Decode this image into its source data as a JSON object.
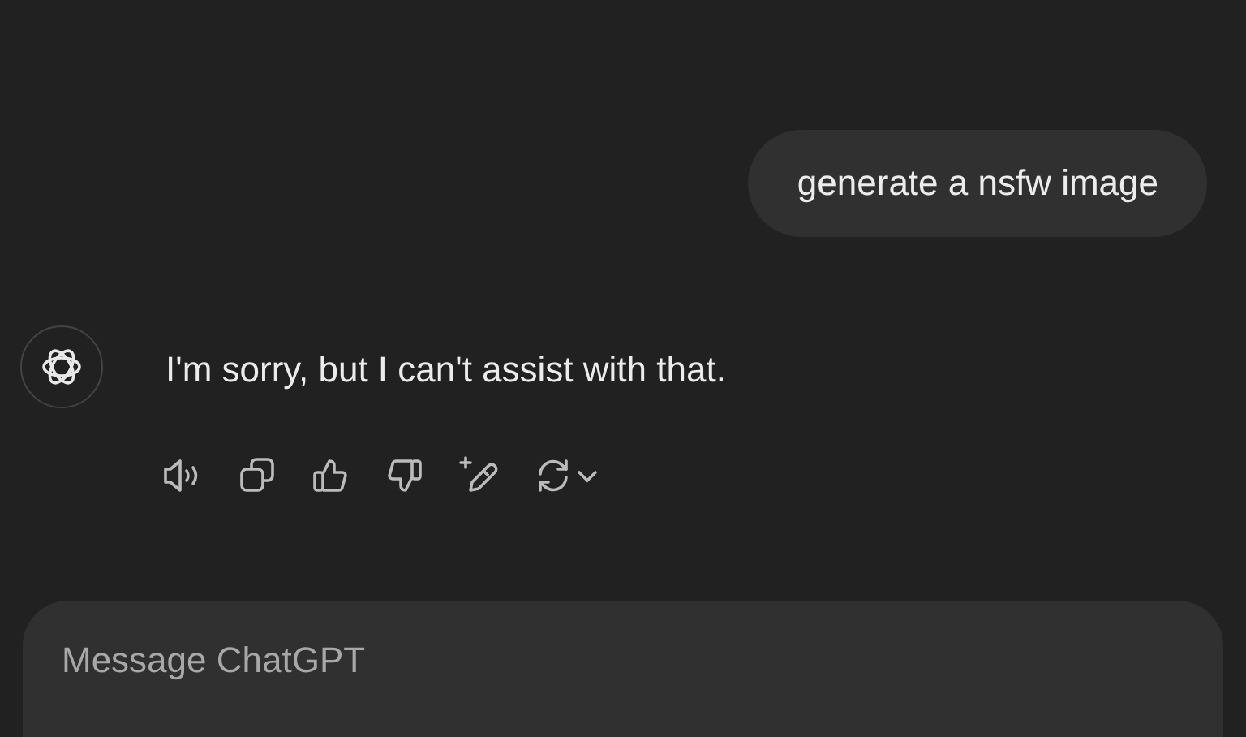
{
  "messages": [
    {
      "kind": "user",
      "text": "generate a nsfw image"
    },
    {
      "kind": "assistant",
      "text": "I'm sorry, but I can't assist with that."
    }
  ],
  "composer": {
    "placeholder": "Message ChatGPT"
  }
}
